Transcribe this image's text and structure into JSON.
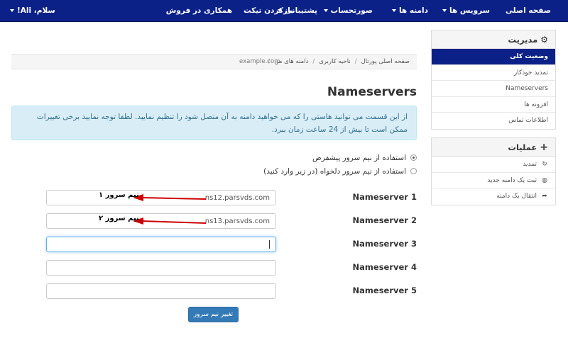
{
  "nav": {
    "home": "صفحه اصلی",
    "services": "سرویس ها",
    "domains": "دامنه ها",
    "billing": "صورتحساب",
    "support": "پشتیبانی",
    "open_ticket": "بازکردن تیکت",
    "affiliates": "همکاری در فروش",
    "greeting": "سلام، Ali!"
  },
  "sidebar": {
    "manage": {
      "title": "مدیریت",
      "icon": "gear-icon",
      "items": [
        "وضعیت کلی",
        "تمدید خودکار",
        "Nameservers",
        "افزونه ها",
        "اطلاعات تماس"
      ]
    },
    "actions": {
      "title": "عملیات",
      "icon": "plus-icon",
      "items": [
        {
          "label": "تمدید",
          "icon": "refresh-icon"
        },
        {
          "label": "ثبت یک دامنه جدید",
          "icon": "globe-icon"
        },
        {
          "label": "انتقال یک دامنه",
          "icon": "share-icon"
        }
      ]
    }
  },
  "breadcrumb": {
    "items": [
      "صفحه اصلی پورتال",
      "ناحیه کاربری",
      "دامنه های من"
    ],
    "active": "example.com"
  },
  "page": {
    "title": "Nameservers",
    "info": "از این قسمت می توانید هاستی را که می خواهید دامنه به آن متصل شود را تنظیم نمایید. لطفا توجه نمایید برخی تغییرات ممکن است تا بیش از 24 ساعت زمان ببرد."
  },
  "options": {
    "default_ns": "استفاده از نیم سرور پیشفرض",
    "custom_ns": "استفاده از نیم سرور دلخواه (در زیر وارد کنید)",
    "selected": "default_ns"
  },
  "nameservers": [
    {
      "label": "Nameserver 1",
      "value": "ns12.parsvds.com",
      "annotation": "نیم سرور ۱"
    },
    {
      "label": "Nameserver 2",
      "value": "ns13.parsvds.com",
      "annotation": "نیم سرور ۲"
    },
    {
      "label": "Nameserver 3",
      "value": ""
    },
    {
      "label": "Nameserver 4",
      "value": ""
    },
    {
      "label": "Nameserver 5",
      "value": ""
    }
  ],
  "submit_label": "تغییر نیم سرور",
  "colors": {
    "navbar": "#0b2187",
    "active_item": "#0b2187",
    "info_bg": "#d9edf7",
    "info_text": "#31708f",
    "button": "#337ab7",
    "arrow": "#cc0000"
  }
}
